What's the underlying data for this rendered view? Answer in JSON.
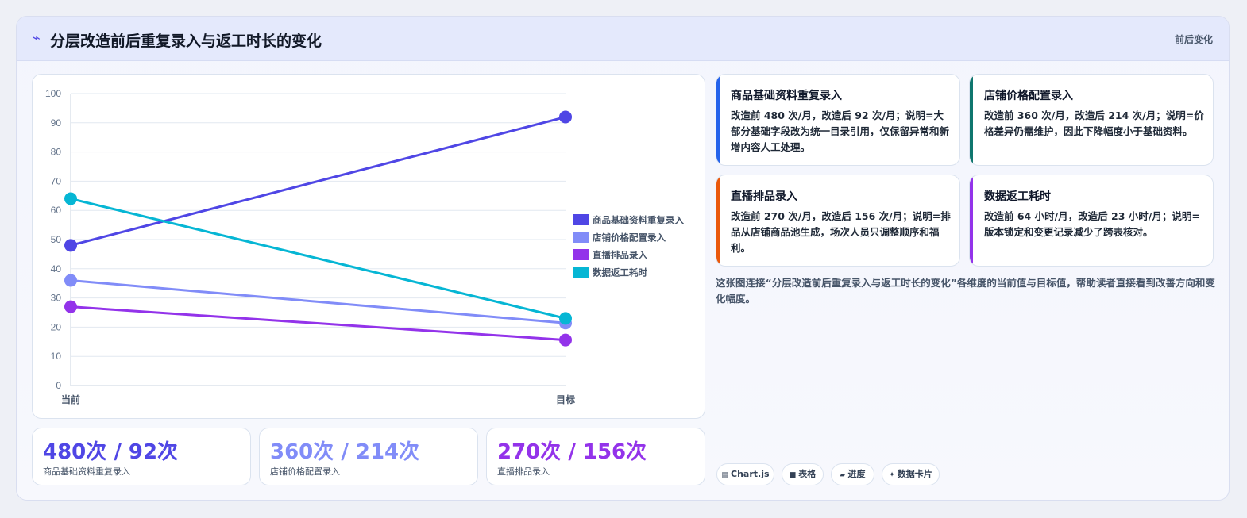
{
  "header": {
    "icon": "chart-line-icon",
    "icon_glyph": "⌁",
    "title": "分层改造前后重复录入与返工时长的变化",
    "tag": "前后变化"
  },
  "chart_data": {
    "type": "line",
    "categories": [
      "当前",
      "目标"
    ],
    "ylim": [
      0,
      100
    ],
    "yticks": [
      0,
      10,
      20,
      30,
      40,
      50,
      60,
      70,
      80,
      90,
      100
    ],
    "grid": true,
    "legend": "right",
    "series": [
      {
        "name": "商品基础资料重复录入",
        "values": [
          48,
          92
        ],
        "color": "#4f46e5"
      },
      {
        "name": "店铺价格配置录入",
        "values": [
          36,
          21.4
        ],
        "color": "#818cf8"
      },
      {
        "name": "直播排品录入",
        "values": [
          27,
          15.6
        ],
        "color": "#9333ea"
      },
      {
        "name": "数据返工耗时",
        "values": [
          64,
          23
        ],
        "color": "#06b6d4"
      }
    ]
  },
  "stats": [
    {
      "value": "480次 / 92次",
      "label": "商品基础资料重复录入",
      "color": "#4f46e5"
    },
    {
      "value": "360次 / 214次",
      "label": "店铺价格配置录入",
      "color": "#818cf8"
    },
    {
      "value": "270次 / 156次",
      "label": "直播排品录入",
      "color": "#9333ea"
    }
  ],
  "cards": [
    {
      "title": "商品基础资料重复录入",
      "body": "改造前 480 次/月，改造后 92 次/月；说明=大部分基础字段改为统一目录引用，仅保留异常和新增内容人工处理。",
      "accent": "#2563eb"
    },
    {
      "title": "店铺价格配置录入",
      "body": "改造前 360 次/月，改造后 214 次/月；说明=价格差异仍需维护，因此下降幅度小于基础资料。",
      "accent": "#0f766e"
    },
    {
      "title": "直播排品录入",
      "body": "改造前 270 次/月，改造后 156 次/月；说明=排品从店铺商品池生成，场次人员只调整顺序和福利。",
      "accent": "#ea580c"
    },
    {
      "title": "数据返工耗时",
      "body": "改造前 64 小时/月，改造后 23 小时/月；说明=版本锁定和变更记录减少了跨表核对。",
      "accent": "#9333ea"
    }
  ],
  "caption": "这张图连接“分层改造前后重复录入与返工时长的变化”各维度的当前值与目标值，帮助读者直接看到改善方向和变化幅度。",
  "chips": [
    {
      "icon": "table-icon",
      "glyph": "▤",
      "label": "Chart.js"
    },
    {
      "icon": "grid-icon",
      "glyph": "■",
      "label": "表格"
    },
    {
      "icon": "progress-icon",
      "glyph": "▰",
      "label": "进度"
    },
    {
      "icon": "sparkle-icon",
      "glyph": "✦",
      "label": "数据卡片"
    }
  ]
}
